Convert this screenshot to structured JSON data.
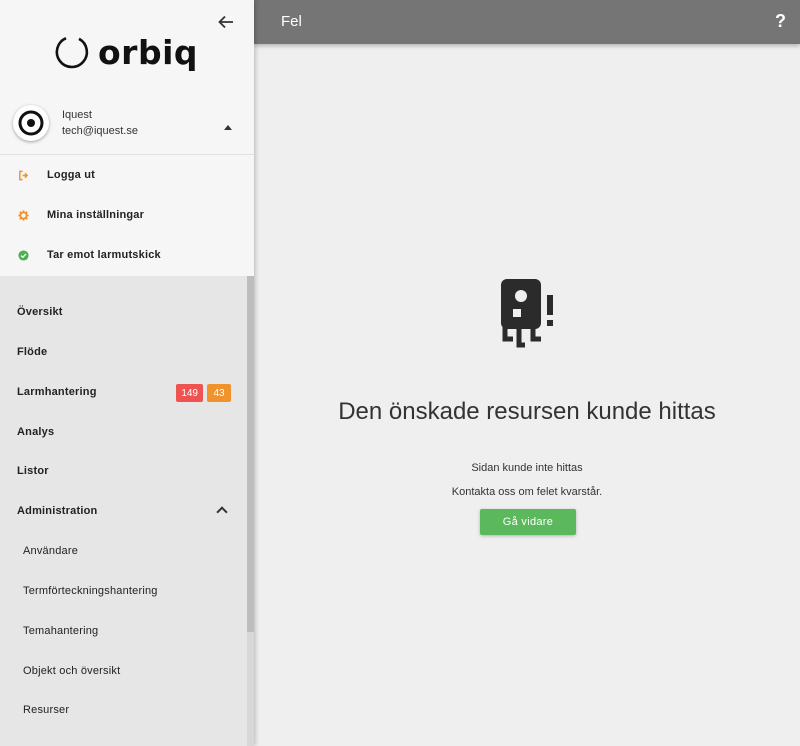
{
  "sidebar": {
    "logo_text": "orbiq",
    "user": {
      "name": "Iquest",
      "email": "tech@iquest.se"
    },
    "user_menu": [
      {
        "label": "Logga ut",
        "icon": "logout-icon",
        "color": "#f0932b"
      },
      {
        "label": "Mina inställningar",
        "icon": "gear-icon",
        "color": "#f0932b"
      },
      {
        "label": "Tar emot larmutskick",
        "icon": "check-circle-icon",
        "color": "#4caf50"
      }
    ],
    "nav": [
      {
        "label": "Översikt"
      },
      {
        "label": "Flöde"
      },
      {
        "label": "Larmhantering",
        "badges": [
          {
            "value": "149",
            "color": "#ef5350"
          },
          {
            "value": "43",
            "color": "#f0932b"
          }
        ]
      },
      {
        "label": "Analys"
      },
      {
        "label": "Listor"
      },
      {
        "label": "Administration",
        "expanded": true
      }
    ],
    "admin_sub": [
      {
        "label": "Användare"
      },
      {
        "label": "Termförteckningshantering"
      },
      {
        "label": "Temahantering"
      },
      {
        "label": "Objekt och översikt"
      },
      {
        "label": "Resurser"
      }
    ]
  },
  "header": {
    "title": "Fel",
    "help": "?"
  },
  "main": {
    "title": "Den önskade resursen kunde hittas",
    "sub1": "Sidan kunde inte hittas",
    "sub2": "Kontakta oss om felet kvarstår.",
    "button": "Gå vidare"
  },
  "colors": {
    "header": "#757575",
    "accent_green": "#5cb85c",
    "badge_red": "#ef5350",
    "badge_orange": "#f0932b"
  }
}
